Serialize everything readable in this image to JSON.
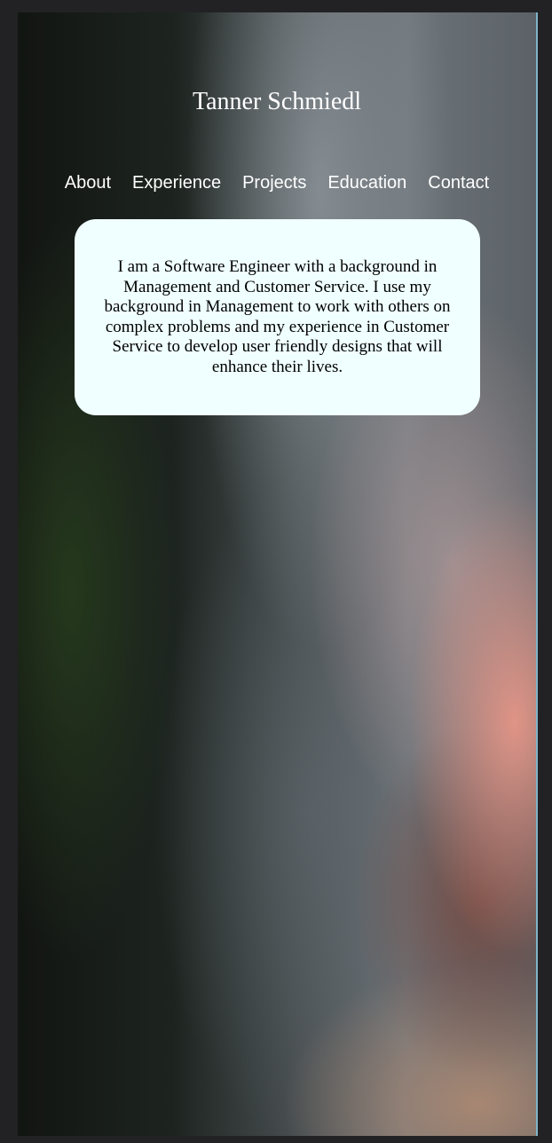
{
  "header": {
    "title": "Tanner Schmiedl"
  },
  "nav": {
    "items": [
      {
        "label": "About"
      },
      {
        "label": "Experience"
      },
      {
        "label": "Projects"
      },
      {
        "label": "Education"
      },
      {
        "label": "Contact"
      }
    ]
  },
  "about": {
    "text": "I am a Software Engineer with a background in Management and Customer Service. I use my background in Management to work with others on complex problems and my experience in Customer Service to develop user friendly designs that will enhance their lives."
  },
  "colors": {
    "card_background": "#f0ffff",
    "text_light": "#ffffff",
    "text_dark": "#000000",
    "window_border_accent": "#7fb3c8"
  }
}
